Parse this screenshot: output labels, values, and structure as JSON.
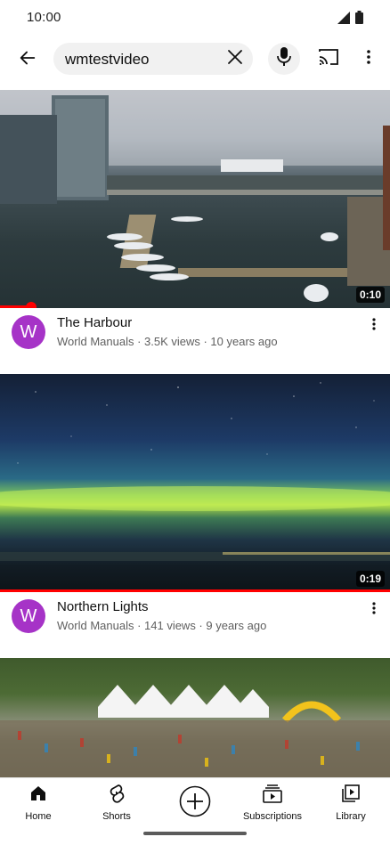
{
  "status_bar": {
    "time": "10:00",
    "icons": [
      "signal-icon",
      "battery-icon"
    ]
  },
  "search": {
    "query": "wmtestvideo",
    "icons": [
      "back-arrow-icon",
      "clear-icon",
      "mic-icon",
      "cast-icon",
      "more-vert-icon"
    ]
  },
  "videos": [
    {
      "title": "The Harbour",
      "channel_initial": "W",
      "subtitle": "World Manuals · 3.5K views · 10 years ago",
      "duration": "0:10",
      "watch_progress": 0.08
    },
    {
      "title": "Northern Lights",
      "channel_initial": "W",
      "subtitle": "World Manuals · 141 views · 9 years ago",
      "duration": "0:19",
      "watch_progress": 1.0
    }
  ],
  "bottom_nav": {
    "items": [
      {
        "label": "Home",
        "icon": "home-icon"
      },
      {
        "label": "Shorts",
        "icon": "shorts-icon"
      },
      {
        "label": "",
        "icon": "create-icon"
      },
      {
        "label": "Subscriptions",
        "icon": "subscriptions-icon"
      },
      {
        "label": "Library",
        "icon": "library-icon"
      }
    ]
  },
  "colors": {
    "accent": "#ff0000",
    "avatar": "#a633c7",
    "pill": "#f1f1f1",
    "secondary_text": "#606060"
  }
}
